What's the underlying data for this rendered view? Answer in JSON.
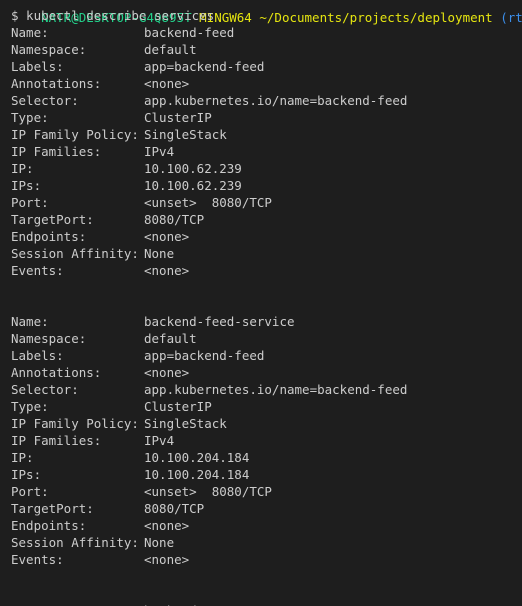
{
  "prompt": {
    "user_host": "NATR@DESKTOP-G4Q895T",
    "shell": "MINGW64",
    "path": "~/Documents/projects/deployment",
    "git_status": "(rt-continüo"
  },
  "command_line": "$ kubectl describe services",
  "services": [
    {
      "rows": [
        {
          "key": "Name:",
          "value": "backend-feed"
        },
        {
          "key": "Namespace:",
          "value": "default"
        },
        {
          "key": "Labels:",
          "value": "app=backend-feed"
        },
        {
          "key": "Annotations:",
          "value": "<none>"
        },
        {
          "key": "Selector:",
          "value": "app.kubernetes.io/name=backend-feed"
        },
        {
          "key": "Type:",
          "value": "ClusterIP"
        },
        {
          "key": "IP Family Policy:",
          "value": "SingleStack"
        },
        {
          "key": "IP Families:",
          "value": "IPv4"
        },
        {
          "key": "IP:",
          "value": "10.100.62.239"
        },
        {
          "key": "IPs:",
          "value": "10.100.62.239"
        },
        {
          "key": "Port:",
          "value": "<unset>  8080/TCP"
        },
        {
          "key": "TargetPort:",
          "value": "8080/TCP"
        },
        {
          "key": "Endpoints:",
          "value": "<none>"
        },
        {
          "key": "Session Affinity:",
          "value": "None"
        },
        {
          "key": "Events:",
          "value": "<none>"
        }
      ]
    },
    {
      "rows": [
        {
          "key": "Name:",
          "value": "backend-feed-service"
        },
        {
          "key": "Namespace:",
          "value": "default"
        },
        {
          "key": "Labels:",
          "value": "app=backend-feed"
        },
        {
          "key": "Annotations:",
          "value": "<none>"
        },
        {
          "key": "Selector:",
          "value": "app.kubernetes.io/name=backend-feed"
        },
        {
          "key": "Type:",
          "value": "ClusterIP"
        },
        {
          "key": "IP Family Policy:",
          "value": "SingleStack"
        },
        {
          "key": "IP Families:",
          "value": "IPv4"
        },
        {
          "key": "IP:",
          "value": "10.100.204.184"
        },
        {
          "key": "IPs:",
          "value": "10.100.204.184"
        },
        {
          "key": "Port:",
          "value": "<unset>  8080/TCP"
        },
        {
          "key": "TargetPort:",
          "value": "8080/TCP"
        },
        {
          "key": "Endpoints:",
          "value": "<none>"
        },
        {
          "key": "Session Affinity:",
          "value": "None"
        },
        {
          "key": "Events:",
          "value": "<none>"
        }
      ]
    }
  ],
  "trailing_partial": {
    "key": "Name:",
    "value": "backend-"
  }
}
